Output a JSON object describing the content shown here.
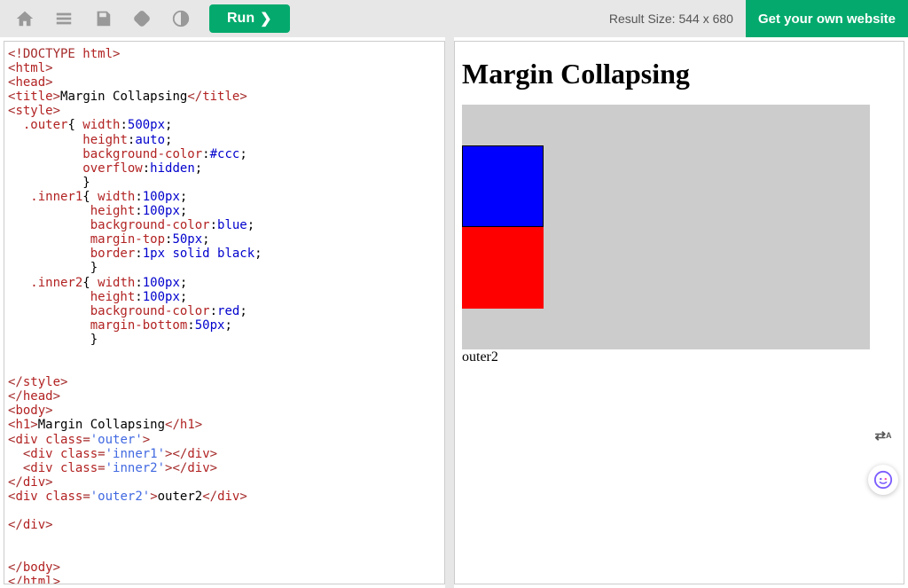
{
  "toolbar": {
    "run_label": "Run",
    "result_size_label": "Result Size: 544 x 680",
    "own_site_label": "Get your own website"
  },
  "editor": {
    "code_lines": [
      {
        "tokens": [
          {
            "c": "brown",
            "t": "<!DOCTYPE "
          },
          {
            "c": "red",
            "t": "html"
          },
          {
            "c": "brown",
            "t": ">"
          }
        ]
      },
      {
        "tokens": [
          {
            "c": "brown",
            "t": "<"
          },
          {
            "c": "red",
            "t": "html"
          },
          {
            "c": "brown",
            "t": ">"
          }
        ]
      },
      {
        "tokens": [
          {
            "c": "brown",
            "t": "<"
          },
          {
            "c": "red",
            "t": "head"
          },
          {
            "c": "brown",
            "t": ">"
          }
        ]
      },
      {
        "tokens": [
          {
            "c": "brown",
            "t": "<"
          },
          {
            "c": "red",
            "t": "title"
          },
          {
            "c": "brown",
            "t": ">"
          },
          {
            "c": "",
            "t": "Margin Collapsing"
          },
          {
            "c": "brown",
            "t": "</"
          },
          {
            "c": "red",
            "t": "title"
          },
          {
            "c": "brown",
            "t": ">"
          }
        ]
      },
      {
        "tokens": [
          {
            "c": "brown",
            "t": "<"
          },
          {
            "c": "red",
            "t": "style"
          },
          {
            "c": "brown",
            "t": ">"
          }
        ]
      },
      {
        "tokens": [
          {
            "c": "red",
            "t": "  .outer"
          },
          {
            "c": "",
            "t": "{ "
          },
          {
            "c": "red",
            "t": "width"
          },
          {
            "c": "",
            "t": ":"
          },
          {
            "c": "blue",
            "t": "500px"
          },
          {
            "c": "",
            "t": ";"
          }
        ]
      },
      {
        "tokens": [
          {
            "c": "",
            "t": "          "
          },
          {
            "c": "red",
            "t": "height"
          },
          {
            "c": "",
            "t": ":"
          },
          {
            "c": "blue",
            "t": "auto"
          },
          {
            "c": "",
            "t": ";"
          }
        ]
      },
      {
        "tokens": [
          {
            "c": "",
            "t": "          "
          },
          {
            "c": "red",
            "t": "background-color"
          },
          {
            "c": "",
            "t": ":"
          },
          {
            "c": "blue",
            "t": "#ccc"
          },
          {
            "c": "",
            "t": ";"
          }
        ]
      },
      {
        "tokens": [
          {
            "c": "",
            "t": "          "
          },
          {
            "c": "red",
            "t": "overflow"
          },
          {
            "c": "",
            "t": ":"
          },
          {
            "c": "blue",
            "t": "hidden"
          },
          {
            "c": "",
            "t": ";"
          }
        ]
      },
      {
        "tokens": [
          {
            "c": "",
            "t": "          }"
          }
        ]
      },
      {
        "tokens": [
          {
            "c": "red",
            "t": "   .inner1"
          },
          {
            "c": "",
            "t": "{ "
          },
          {
            "c": "red",
            "t": "width"
          },
          {
            "c": "",
            "t": ":"
          },
          {
            "c": "blue",
            "t": "100px"
          },
          {
            "c": "",
            "t": ";"
          }
        ]
      },
      {
        "tokens": [
          {
            "c": "",
            "t": "           "
          },
          {
            "c": "red",
            "t": "height"
          },
          {
            "c": "",
            "t": ":"
          },
          {
            "c": "blue",
            "t": "100px"
          },
          {
            "c": "",
            "t": ";"
          }
        ]
      },
      {
        "tokens": [
          {
            "c": "",
            "t": "           "
          },
          {
            "c": "red",
            "t": "background-color"
          },
          {
            "c": "",
            "t": ":"
          },
          {
            "c": "blue",
            "t": "blue"
          },
          {
            "c": "",
            "t": ";"
          }
        ]
      },
      {
        "tokens": [
          {
            "c": "",
            "t": "           "
          },
          {
            "c": "red",
            "t": "margin-top"
          },
          {
            "c": "",
            "t": ":"
          },
          {
            "c": "blue",
            "t": "50px"
          },
          {
            "c": "",
            "t": ";"
          }
        ]
      },
      {
        "tokens": [
          {
            "c": "",
            "t": "           "
          },
          {
            "c": "red",
            "t": "border"
          },
          {
            "c": "",
            "t": ":"
          },
          {
            "c": "blue",
            "t": "1px solid black"
          },
          {
            "c": "",
            "t": ";"
          }
        ]
      },
      {
        "tokens": [
          {
            "c": "",
            "t": "           }"
          }
        ]
      },
      {
        "tokens": [
          {
            "c": "red",
            "t": "   .inner2"
          },
          {
            "c": "",
            "t": "{ "
          },
          {
            "c": "red",
            "t": "width"
          },
          {
            "c": "",
            "t": ":"
          },
          {
            "c": "blue",
            "t": "100px"
          },
          {
            "c": "",
            "t": ";"
          }
        ]
      },
      {
        "tokens": [
          {
            "c": "",
            "t": "           "
          },
          {
            "c": "red",
            "t": "height"
          },
          {
            "c": "",
            "t": ":"
          },
          {
            "c": "blue",
            "t": "100px"
          },
          {
            "c": "",
            "t": ";"
          }
        ]
      },
      {
        "tokens": [
          {
            "c": "",
            "t": "           "
          },
          {
            "c": "red",
            "t": "background-color"
          },
          {
            "c": "",
            "t": ":"
          },
          {
            "c": "blue",
            "t": "red"
          },
          {
            "c": "",
            "t": ";"
          }
        ]
      },
      {
        "tokens": [
          {
            "c": "",
            "t": "           "
          },
          {
            "c": "red",
            "t": "margin-bottom"
          },
          {
            "c": "",
            "t": ":"
          },
          {
            "c": "blue",
            "t": "50px"
          },
          {
            "c": "",
            "t": ";"
          }
        ]
      },
      {
        "tokens": [
          {
            "c": "",
            "t": "           }"
          }
        ]
      },
      {
        "tokens": [
          {
            "c": "",
            "t": ""
          }
        ]
      },
      {
        "tokens": [
          {
            "c": "",
            "t": ""
          }
        ]
      },
      {
        "tokens": [
          {
            "c": "brown",
            "t": "</"
          },
          {
            "c": "red",
            "t": "style"
          },
          {
            "c": "brown",
            "t": ">"
          }
        ]
      },
      {
        "tokens": [
          {
            "c": "brown",
            "t": "</"
          },
          {
            "c": "red",
            "t": "head"
          },
          {
            "c": "brown",
            "t": ">"
          }
        ]
      },
      {
        "tokens": [
          {
            "c": "brown",
            "t": "<"
          },
          {
            "c": "red",
            "t": "body"
          },
          {
            "c": "brown",
            "t": ">"
          }
        ]
      },
      {
        "tokens": [
          {
            "c": "brown",
            "t": "<"
          },
          {
            "c": "red",
            "t": "h1"
          },
          {
            "c": "brown",
            "t": ">"
          },
          {
            "c": "",
            "t": "Margin Collapsing"
          },
          {
            "c": "brown",
            "t": "</"
          },
          {
            "c": "red",
            "t": "h1"
          },
          {
            "c": "brown",
            "t": ">"
          }
        ]
      },
      {
        "tokens": [
          {
            "c": "brown",
            "t": "<"
          },
          {
            "c": "red",
            "t": "div "
          },
          {
            "c": "red",
            "t": "class"
          },
          {
            "c": "brown",
            "t": "="
          },
          {
            "c": "med",
            "t": "'outer'"
          },
          {
            "c": "brown",
            "t": ">"
          }
        ]
      },
      {
        "tokens": [
          {
            "c": "",
            "t": "  "
          },
          {
            "c": "brown",
            "t": "<"
          },
          {
            "c": "red",
            "t": "div "
          },
          {
            "c": "red",
            "t": "class"
          },
          {
            "c": "brown",
            "t": "="
          },
          {
            "c": "med",
            "t": "'inner1'"
          },
          {
            "c": "brown",
            "t": "></"
          },
          {
            "c": "red",
            "t": "div"
          },
          {
            "c": "brown",
            "t": ">"
          }
        ]
      },
      {
        "tokens": [
          {
            "c": "",
            "t": "  "
          },
          {
            "c": "brown",
            "t": "<"
          },
          {
            "c": "red",
            "t": "div "
          },
          {
            "c": "red",
            "t": "class"
          },
          {
            "c": "brown",
            "t": "="
          },
          {
            "c": "med",
            "t": "'inner2'"
          },
          {
            "c": "brown",
            "t": "></"
          },
          {
            "c": "red",
            "t": "div"
          },
          {
            "c": "brown",
            "t": ">"
          }
        ]
      },
      {
        "tokens": [
          {
            "c": "brown",
            "t": "</"
          },
          {
            "c": "red",
            "t": "div"
          },
          {
            "c": "brown",
            "t": ">"
          }
        ]
      },
      {
        "tokens": [
          {
            "c": "brown",
            "t": "<"
          },
          {
            "c": "red",
            "t": "div "
          },
          {
            "c": "red",
            "t": "class"
          },
          {
            "c": "brown",
            "t": "="
          },
          {
            "c": "med",
            "t": "'outer2'"
          },
          {
            "c": "brown",
            "t": ">"
          },
          {
            "c": "",
            "t": "outer2"
          },
          {
            "c": "brown",
            "t": "</"
          },
          {
            "c": "red",
            "t": "div"
          },
          {
            "c": "brown",
            "t": ">"
          }
        ]
      },
      {
        "tokens": [
          {
            "c": "",
            "t": ""
          }
        ]
      },
      {
        "tokens": [
          {
            "c": "brown",
            "t": "</"
          },
          {
            "c": "red",
            "t": "div"
          },
          {
            "c": "brown",
            "t": ">"
          }
        ]
      },
      {
        "tokens": [
          {
            "c": "",
            "t": ""
          }
        ]
      },
      {
        "tokens": [
          {
            "c": "",
            "t": ""
          }
        ]
      },
      {
        "tokens": [
          {
            "c": "brown",
            "t": "</"
          },
          {
            "c": "red",
            "t": "body"
          },
          {
            "c": "brown",
            "t": ">"
          }
        ]
      },
      {
        "tokens": [
          {
            "c": "brown",
            "t": "</"
          },
          {
            "c": "red",
            "t": "html"
          },
          {
            "c": "brown",
            "t": ">"
          }
        ]
      }
    ]
  },
  "result": {
    "heading": "Margin Collapsing",
    "outer2_text": "outer2"
  }
}
